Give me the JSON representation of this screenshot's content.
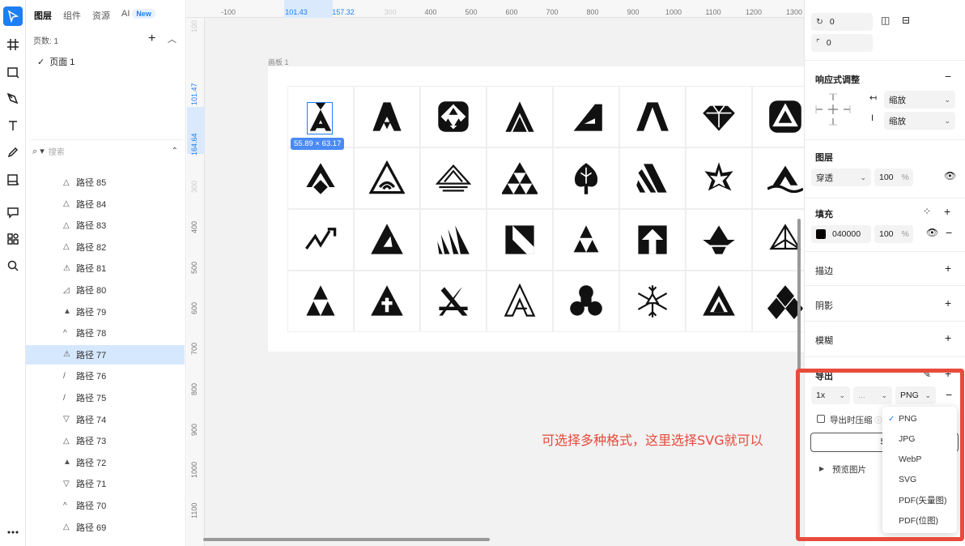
{
  "left_panel": {
    "tabs": [
      "图层",
      "组件",
      "资源",
      "AI"
    ],
    "new_badge": "New",
    "page_count": "页数: 1",
    "page_name": "页面 1",
    "search_placeholder": "搜索",
    "layers": [
      {
        "label": "路径 85",
        "icon": "triangle-outline-icon"
      },
      {
        "label": "路径 84",
        "icon": "triangle-outline-icon"
      },
      {
        "label": "路径 83",
        "icon": "triangle-outline-icon"
      },
      {
        "label": "路径 82",
        "icon": "triangle-outline-icon"
      },
      {
        "label": "路径 81",
        "icon": "triangle-letter-icon"
      },
      {
        "label": "路径 80",
        "icon": "striped-triangle-icon"
      },
      {
        "label": "路径 79",
        "icon": "triangle-filled-icon"
      },
      {
        "label": "路径 78",
        "icon": "chevron-up-icon"
      },
      {
        "label": "路径 77",
        "icon": "triangle-letter-icon",
        "selected": true
      },
      {
        "label": "路径 76",
        "icon": "slash-shape-icon"
      },
      {
        "label": "路径 75",
        "icon": "slash-shape-icon"
      },
      {
        "label": "路径 74",
        "icon": "triangle-down-icon"
      },
      {
        "label": "路径 73",
        "icon": "triangle-outline-icon"
      },
      {
        "label": "路径 72",
        "icon": "triangle-filled-icon"
      },
      {
        "label": "路径 71",
        "icon": "triangle-down-icon"
      },
      {
        "label": "路径 70",
        "icon": "chevron-up-icon"
      },
      {
        "label": "路径 69",
        "icon": "triangle-outline-icon"
      }
    ]
  },
  "canvas": {
    "ruler_top": [
      "-100",
      "101.43",
      "157.32",
      "300",
      "400",
      "500",
      "600",
      "700",
      "800",
      "900",
      "1000",
      "1100",
      "1200",
      "1300"
    ],
    "ruler_left": [
      "100",
      "101.47",
      "164.64",
      "300",
      "400",
      "500",
      "600",
      "700",
      "800",
      "900",
      "1000",
      "1100"
    ],
    "artboard_label": "画板 1",
    "selection_size": "55.89 × 63.17",
    "annotation": "可选择多种格式，这里选择SVG就可以"
  },
  "right_panel": {
    "rotation_value": "0",
    "radius_value": "0",
    "responsive": {
      "title": "响应式调整",
      "horizontal": "缩放",
      "vertical": "缩放"
    },
    "layer": {
      "title": "图层",
      "blend": "穿透",
      "opacity": "100",
      "unit": "%"
    },
    "fill": {
      "title": "填充",
      "color_hex": "040000",
      "swatch_color": "#040000",
      "opacity": "100",
      "unit": "%"
    },
    "stroke_title": "描边",
    "shadow_title": "阴影",
    "blur_title": "模糊",
    "export": {
      "title": "导出",
      "scale": "1x",
      "suffix": "...",
      "format": "PNG",
      "compress_label": "导出时压缩",
      "button_label": "导",
      "preview_label": "预览图片",
      "format_options": [
        "PNG",
        "JPG",
        "WebP",
        "SVG",
        "PDF(矢量图)",
        "PDF(位图)"
      ],
      "selected_option": "PNG"
    }
  },
  "colors": {
    "accent": "#1e7ef3",
    "annotation": "#e64a3b",
    "highlight_frame": "#e84b3c",
    "selected_row": "#d6e8fd"
  }
}
